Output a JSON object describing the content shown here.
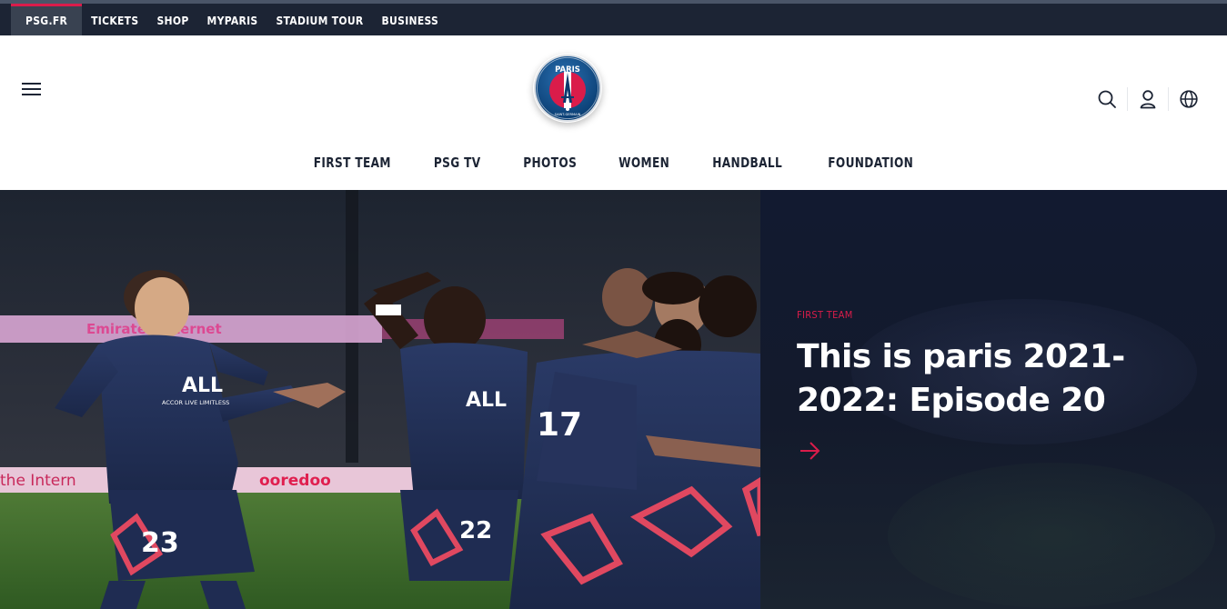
{
  "topbar": {
    "links": [
      {
        "label": "PSG.FR",
        "active": true
      },
      {
        "label": "TICKETS",
        "active": false
      },
      {
        "label": "SHOP",
        "active": false
      },
      {
        "label": "MYPARIS",
        "active": false
      },
      {
        "label": "STADIUM TOUR",
        "active": false
      },
      {
        "label": "BUSINESS",
        "active": false
      }
    ]
  },
  "header": {
    "menu_icon": "hamburger-menu-icon",
    "logo": {
      "text_top": "PARIS",
      "text_bottom": "SAINT-GERMAIN"
    },
    "icons": [
      "search-icon",
      "user-icon",
      "globe-icon"
    ]
  },
  "nav": {
    "items": [
      "FIRST TEAM",
      "PSG TV",
      "PHOTOS",
      "WOMEN",
      "HANDBALL",
      "FOUNDATION"
    ]
  },
  "hero": {
    "kicker": "FIRST TEAM",
    "title": "This is paris 2021-2022: Episode 20",
    "arrow_icon": "arrow-right-icon",
    "photo": {
      "banner_left": "Emirates internet",
      "banner_bottom_left": "the Intern",
      "banner_bottom_mid": "ooredoo",
      "sponsor_shirt": "ALL",
      "sponsor_sub": "ACCOR LIVE LIMITLESS",
      "numbers": [
        "23",
        "22",
        "17"
      ]
    }
  },
  "colors": {
    "navy": "#1c2434",
    "accent_red": "#da1c4a",
    "psg_blue": "#004170",
    "panel_bg": "#131a2c"
  }
}
